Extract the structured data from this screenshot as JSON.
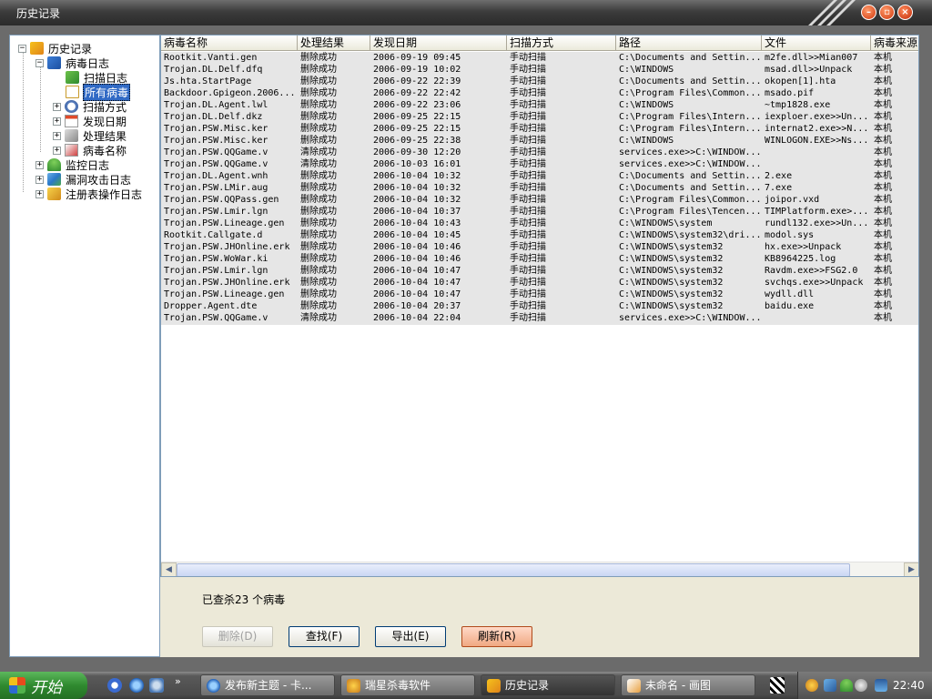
{
  "window": {
    "title": "历史记录"
  },
  "tree": {
    "root": "历史记录",
    "virus_log": "病毒日志",
    "scan_log": "扫描日志",
    "all_viruses": "所有病毒",
    "scan_method": "扫描方式",
    "found_date": "发现日期",
    "result": "处理结果",
    "virus_name": "病毒名称",
    "monitor_log": "监控日志",
    "exploit_log": "漏洞攻击日志",
    "registry_log": "注册表操作日志"
  },
  "columns": [
    "病毒名称",
    "处理结果",
    "发现日期",
    "扫描方式",
    "路径",
    "文件",
    "病毒来源"
  ],
  "rows": [
    [
      "Rootkit.Vanti.gen",
      "删除成功",
      "2006-09-19 09:45",
      "手动扫描",
      "C:\\Documents and Settin...",
      "m2fe.dll>>Mian007",
      "本机"
    ],
    [
      "Trojan.DL.Delf.dfq",
      "删除成功",
      "2006-09-19 10:02",
      "手动扫描",
      "C:\\WINDOWS",
      "msad.dll>>Unpack",
      "本机"
    ],
    [
      "Js.hta.StartPage",
      "删除成功",
      "2006-09-22 22:39",
      "手动扫描",
      "C:\\Documents and Settin...",
      "okopen[1].hta",
      "本机"
    ],
    [
      "Backdoor.Gpigeon.2006...",
      "删除成功",
      "2006-09-22 22:42",
      "手动扫描",
      "C:\\Program Files\\Common...",
      "msado.pif",
      "本机"
    ],
    [
      "Trojan.DL.Agent.lwl",
      "删除成功",
      "2006-09-22 23:06",
      "手动扫描",
      "C:\\WINDOWS",
      "~tmp1828.exe",
      "本机"
    ],
    [
      "Trojan.DL.Delf.dkz",
      "删除成功",
      "2006-09-25 22:15",
      "手动扫描",
      "C:\\Program Files\\Intern...",
      "iexploer.exe>>Un...",
      "本机"
    ],
    [
      "Trojan.PSW.Misc.ker",
      "删除成功",
      "2006-09-25 22:15",
      "手动扫描",
      "C:\\Program Files\\Intern...",
      "internat2.exe>>N...",
      "本机"
    ],
    [
      "Trojan.PSW.Misc.ker",
      "删除成功",
      "2006-09-25 22:38",
      "手动扫描",
      "C:\\WINDOWS",
      "WINLOGON.EXE>>Ns...",
      "本机"
    ],
    [
      "Trojan.PSW.QQGame.v",
      "清除成功",
      "2006-09-30 12:20",
      "手动扫描",
      "services.exe>>C:\\WINDOW...",
      "",
      "本机"
    ],
    [
      "Trojan.PSW.QQGame.v",
      "清除成功",
      "2006-10-03 16:01",
      "手动扫描",
      "services.exe>>C:\\WINDOW...",
      "",
      "本机"
    ],
    [
      "Trojan.DL.Agent.wnh",
      "删除成功",
      "2006-10-04 10:32",
      "手动扫描",
      "C:\\Documents and Settin...",
      "2.exe",
      "本机"
    ],
    [
      "Trojan.PSW.LMir.aug",
      "删除成功",
      "2006-10-04 10:32",
      "手动扫描",
      "C:\\Documents and Settin...",
      "7.exe",
      "本机"
    ],
    [
      "Trojan.PSW.QQPass.gen",
      "删除成功",
      "2006-10-04 10:32",
      "手动扫描",
      "C:\\Program Files\\Common...",
      "joipor.vxd",
      "本机"
    ],
    [
      "Trojan.PSW.Lmir.lgn",
      "删除成功",
      "2006-10-04 10:37",
      "手动扫描",
      "C:\\Program Files\\Tencen...",
      "TIMPlatform.exe>...",
      "本机"
    ],
    [
      "Trojan.PSW.Lineage.gen",
      "删除成功",
      "2006-10-04 10:43",
      "手动扫描",
      "C:\\WINDOWS\\system",
      "rundl132.exe>>Un...",
      "本机"
    ],
    [
      "Rootkit.Callgate.d",
      "删除成功",
      "2006-10-04 10:45",
      "手动扫描",
      "C:\\WINDOWS\\system32\\dri...",
      "modol.sys",
      "本机"
    ],
    [
      "Trojan.PSW.JHOnline.erk",
      "删除成功",
      "2006-10-04 10:46",
      "手动扫描",
      "C:\\WINDOWS\\system32",
      "hx.exe>>Unpack",
      "本机"
    ],
    [
      "Trojan.PSW.WoWar.ki",
      "删除成功",
      "2006-10-04 10:46",
      "手动扫描",
      "C:\\WINDOWS\\system32",
      "KB8964225.log",
      "本机"
    ],
    [
      "Trojan.PSW.Lmir.lgn",
      "删除成功",
      "2006-10-04 10:47",
      "手动扫描",
      "C:\\WINDOWS\\system32",
      "Ravdm.exe>>FSG2.0",
      "本机"
    ],
    [
      "Trojan.PSW.JHOnline.erk",
      "删除成功",
      "2006-10-04 10:47",
      "手动扫描",
      "C:\\WINDOWS\\system32",
      "svchqs.exe>>Unpack",
      "本机"
    ],
    [
      "Trojan.PSW.Lineage.gen",
      "删除成功",
      "2006-10-04 10:47",
      "手动扫描",
      "C:\\WINDOWS\\system32",
      "wydll.dll",
      "本机"
    ],
    [
      "Dropper.Agent.dte",
      "删除成功",
      "2006-10-04 20:37",
      "手动扫描",
      "C:\\WINDOWS\\system32",
      "baidu.exe",
      "本机"
    ],
    [
      "Trojan.PSW.QQGame.v",
      "清除成功",
      "2006-10-04 22:04",
      "手动扫描",
      "services.exe>>C:\\WINDOW...",
      "",
      "本机"
    ]
  ],
  "status": "已查杀23 个病毒",
  "buttons": {
    "delete": "删除(D)",
    "find": "查找(F)",
    "export": "导出(E)",
    "refresh": "刷新(R)"
  },
  "taskbar": {
    "start": "开始",
    "tasks": [
      "发布新主题 - 卡...",
      "瑞星杀毒软件",
      "历史记录",
      "未命名 - 画图"
    ],
    "clock": "22:40"
  },
  "colors": {
    "selection": "#316ac5",
    "row_bg": "#e6e6e6",
    "titlebar": "#3c3c3c",
    "refresh_button": "#f0a882"
  }
}
